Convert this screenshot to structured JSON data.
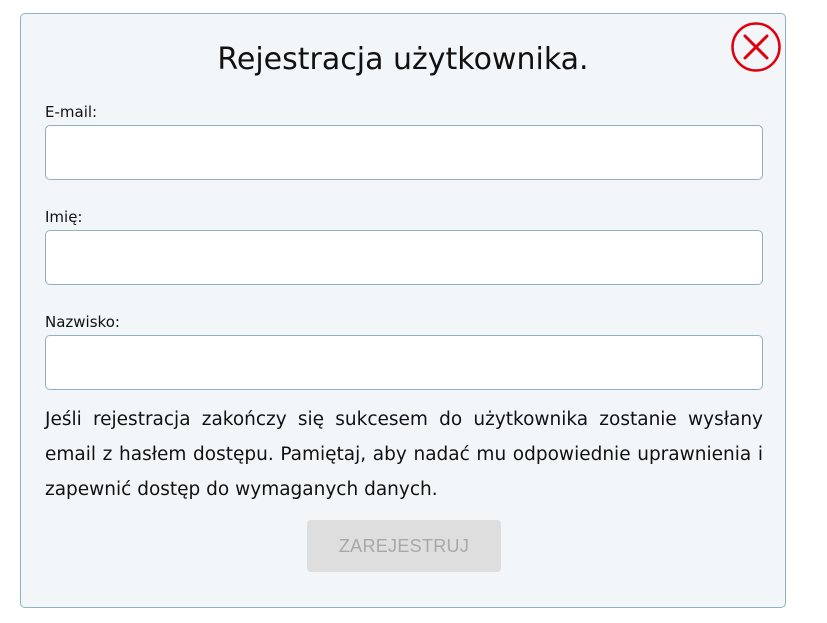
{
  "dialog": {
    "title": "Rejestracja użytkownika.",
    "close_icon": "close-circle-x-icon"
  },
  "form": {
    "email": {
      "label": "E-mail:",
      "value": "",
      "placeholder": ""
    },
    "first_name": {
      "label": "Imię:",
      "value": "",
      "placeholder": ""
    },
    "last_name": {
      "label": "Nazwisko:",
      "value": "",
      "placeholder": ""
    }
  },
  "info_text": "Jeśli rejestracja zakończy się sukcesem do użytkownika zostanie wysłany email z hasłem dostępu. Pamiętaj, aby nadać mu odpowiednie uprawnienia i zapewnić dostęp do wymaganych danych.",
  "submit": {
    "label": "ZAREJESTRUJ",
    "disabled": true
  },
  "colors": {
    "panel_background": "#f3f6f9",
    "border": "#8fb2c0",
    "close_icon": "#e0000d",
    "button_background_disabled": "#dedede",
    "button_text_disabled": "#a8a8a8"
  }
}
